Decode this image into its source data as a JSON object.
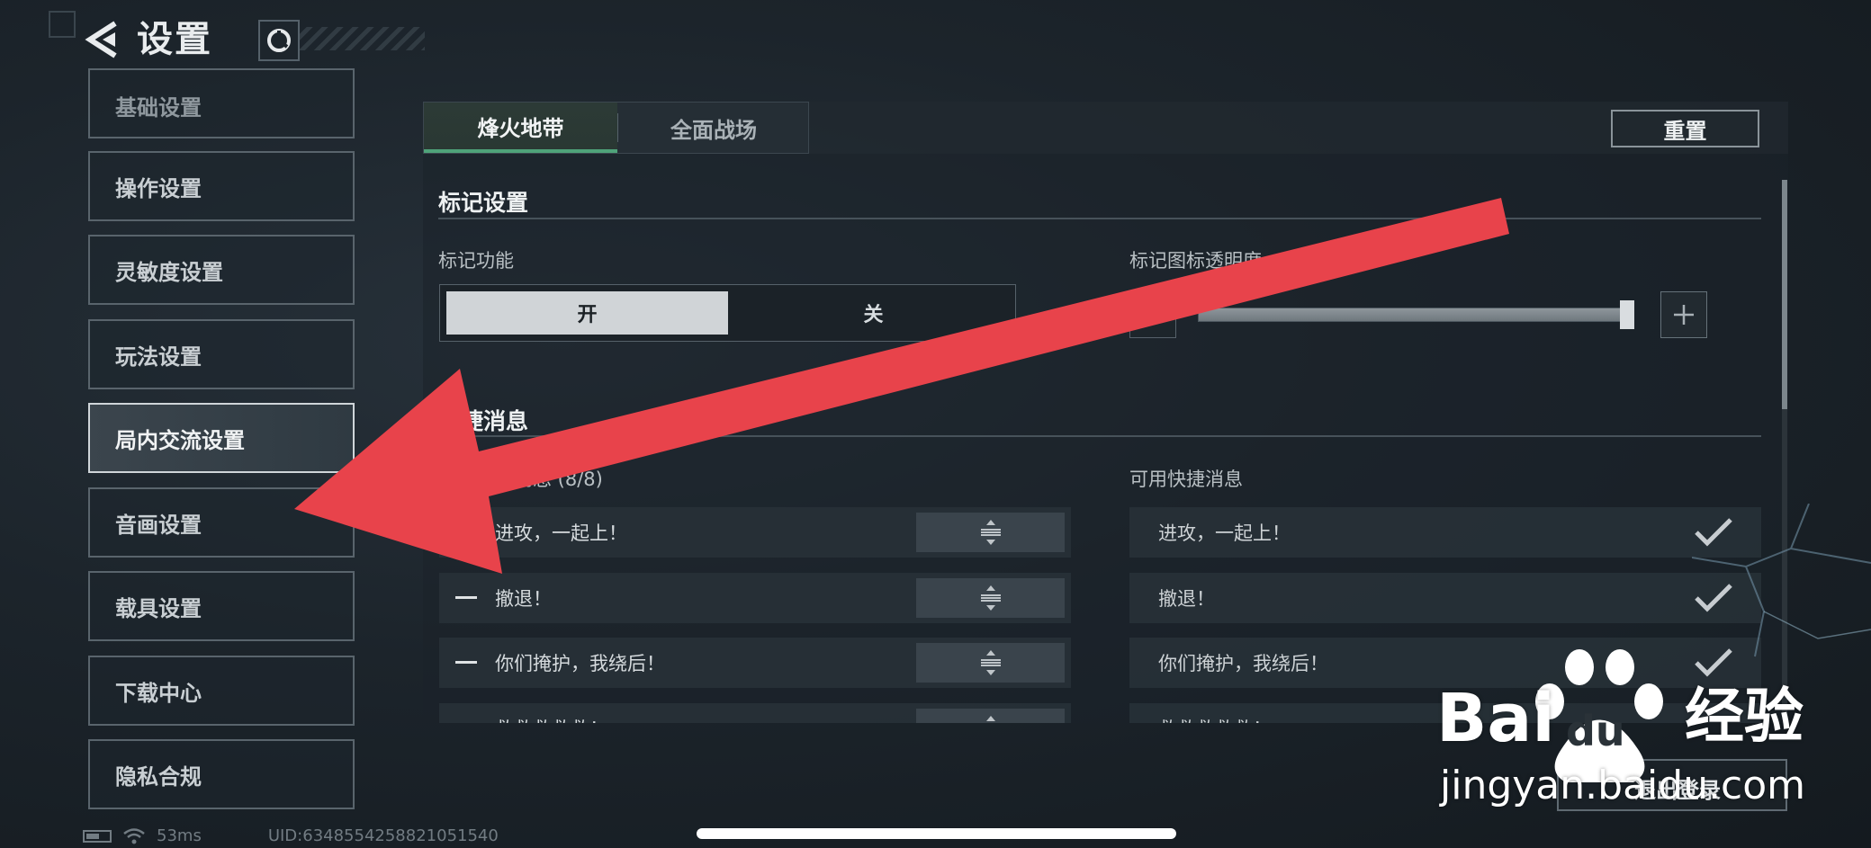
{
  "header": {
    "title": "设置"
  },
  "sidebar": {
    "items": [
      {
        "label": "基础设置"
      },
      {
        "label": "操作设置"
      },
      {
        "label": "灵敏度设置"
      },
      {
        "label": "玩法设置"
      },
      {
        "label": "局内交流设置",
        "active": true
      },
      {
        "label": "音画设置"
      },
      {
        "label": "载具设置"
      },
      {
        "label": "下载中心"
      },
      {
        "label": "隐私合规"
      }
    ]
  },
  "tabs": [
    {
      "label": "烽火地带",
      "active": true
    },
    {
      "label": "全面战场",
      "active": false
    }
  ],
  "reset_label": "重置",
  "mark_section": {
    "title": "标记设置",
    "function_label": "标记功能",
    "on_label": "开",
    "off_label": "关",
    "opacity_label": "标记图标透明度",
    "opacity_value_percent": 100
  },
  "quick_msg_section": {
    "title": "快捷消息",
    "carried_label": "携带快捷消息 (8/8)",
    "available_label": "可用快捷消息",
    "carried": [
      "进攻，一起上！",
      "撤退！",
      "你们掩护，我绕后！",
      "救救救救救！"
    ],
    "available": [
      "进攻，一起上！",
      "撤退！",
      "你们掩护，我绕后！",
      "救救救救救！"
    ]
  },
  "status": {
    "ping": "53ms",
    "uid": "UID:6348554258821051540"
  },
  "bottom_button_label": "退出登录",
  "watermark": {
    "brand_text": "Bai",
    "brand_suffix": "经验",
    "paw_text": "du",
    "domain": "jingyan.baidu.com"
  },
  "colors": {
    "accent_green": "#4fa37a",
    "annotation_red": "#e8434b"
  }
}
